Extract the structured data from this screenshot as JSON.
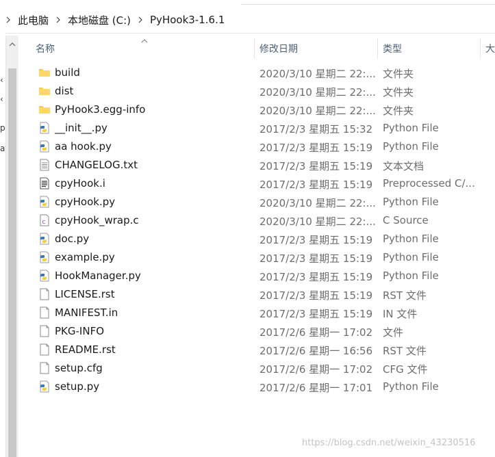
{
  "breadcrumb": {
    "items": [
      {
        "label": "此电脑"
      },
      {
        "label": "本地磁盘 (C:)"
      },
      {
        "label": "PyHook3-1.6.1"
      }
    ]
  },
  "columns": {
    "name": "名称",
    "date": "修改日期",
    "type": "类型",
    "size": "大"
  },
  "nav_fragments": [
    "p",
    "at"
  ],
  "files": [
    {
      "name": "build",
      "date": "2020/3/10 星期二 22:...",
      "type": "文件夹",
      "icon": "folder-icon"
    },
    {
      "name": "dist",
      "date": "2020/3/10 星期二 22:...",
      "type": "文件夹",
      "icon": "folder-icon"
    },
    {
      "name": "PyHook3.egg-info",
      "date": "2020/3/10 星期二 22:...",
      "type": "文件夹",
      "icon": "folder-icon"
    },
    {
      "name": "__init__.py",
      "date": "2017/2/3 星期五 15:32",
      "type": "Python File",
      "icon": "python-file-icon"
    },
    {
      "name": "aa hook.py",
      "date": "2017/2/3 星期五 15:19",
      "type": "Python File",
      "icon": "python-file-icon"
    },
    {
      "name": "CHANGELOG.txt",
      "date": "2017/2/3 星期五 15:19",
      "type": "文本文档",
      "icon": "text-file-icon"
    },
    {
      "name": "cpyHook.i",
      "date": "2017/2/3 星期五 15:19",
      "type": "Preprocessed C/...",
      "icon": "document-file-icon"
    },
    {
      "name": "cpyHook.py",
      "date": "2020/3/10 星期二 22:...",
      "type": "Python File",
      "icon": "python-file-icon"
    },
    {
      "name": "cpyHook_wrap.c",
      "date": "2020/3/10 星期二 22:...",
      "type": "C Source",
      "icon": "c-source-file-icon"
    },
    {
      "name": "doc.py",
      "date": "2017/2/3 星期五 15:19",
      "type": "Python File",
      "icon": "python-file-icon"
    },
    {
      "name": "example.py",
      "date": "2017/2/3 星期五 15:19",
      "type": "Python File",
      "icon": "python-file-icon"
    },
    {
      "name": "HookManager.py",
      "date": "2017/2/3 星期五 15:19",
      "type": "Python File",
      "icon": "python-file-icon"
    },
    {
      "name": "LICENSE.rst",
      "date": "2017/2/3 星期五 15:19",
      "type": "RST 文件",
      "icon": "blank-file-icon"
    },
    {
      "name": "MANIFEST.in",
      "date": "2017/2/3 星期五 15:19",
      "type": "IN 文件",
      "icon": "blank-file-icon"
    },
    {
      "name": "PKG-INFO",
      "date": "2017/2/6 星期一 17:02",
      "type": "文件",
      "icon": "blank-file-icon"
    },
    {
      "name": "README.rst",
      "date": "2017/2/6 星期一 16:56",
      "type": "RST 文件",
      "icon": "blank-file-icon"
    },
    {
      "name": "setup.cfg",
      "date": "2017/2/6 星期一 17:02",
      "type": "CFG 文件",
      "icon": "blank-file-icon"
    },
    {
      "name": "setup.py",
      "date": "2017/2/6 星期一 17:01",
      "type": "Python File",
      "icon": "python-file-icon"
    }
  ],
  "watermark": "https://blog.csdn.net/weixin_43230516",
  "colors": {
    "folder": "#f8c94c",
    "python_blue": "#3b78b5",
    "python_yellow": "#f5cf3a",
    "header_text": "#4c607a",
    "secondary_text": "#6d6d6d"
  }
}
